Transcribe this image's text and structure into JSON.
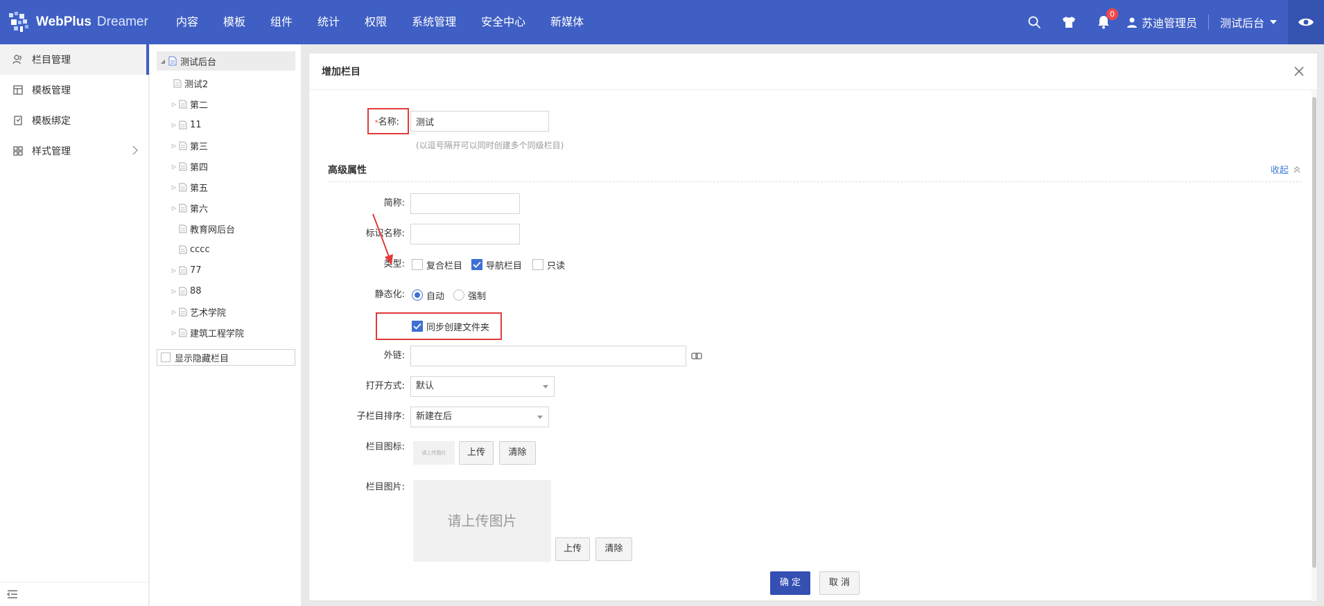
{
  "topbar": {
    "brand": "WebPlus",
    "brand_sub": "Dreamer",
    "nav": [
      "内容",
      "模板",
      "组件",
      "统计",
      "权限",
      "系统管理",
      "安全中心",
      "新媒体"
    ],
    "notification_count": "0",
    "user_name": "苏迪管理员",
    "site_name": "测试后台",
    "bg_color": "#3f5fc4"
  },
  "left_menu": {
    "items": [
      {
        "label": "栏目管理",
        "icon": "users-icon",
        "active": true
      },
      {
        "label": "模板管理",
        "icon": "layout-icon"
      },
      {
        "label": "模板绑定",
        "icon": "binding-icon"
      },
      {
        "label": "样式管理",
        "icon": "grid-icon"
      }
    ]
  },
  "tree": {
    "root": "测试后台",
    "children": [
      "测试2",
      "第二",
      "11",
      "第三",
      "第四",
      "第五",
      "第六",
      "教育网后台",
      "cccc",
      "77",
      "88",
      "艺术学院",
      "建筑工程学院"
    ],
    "show_hidden_label": "显示隐藏栏目"
  },
  "dialog": {
    "title": "增加栏目",
    "name_label": "名称:",
    "name_value": "测试",
    "name_hint": "(以逗号隔开可以同时创建多个同级栏目)",
    "advanced_title": "高级属性",
    "collapse_label": "收起",
    "short_name_label": "简称:",
    "id_name_label": "标识名称:",
    "type_label": "类型:",
    "type_options": [
      {
        "label": "复合栏目",
        "checked": false
      },
      {
        "label": "导航栏目",
        "checked": true
      },
      {
        "label": "只读",
        "checked": false
      }
    ],
    "static_label": "静态化:",
    "static_options": [
      {
        "label": "自动",
        "selected": true
      },
      {
        "label": "强制",
        "selected": false
      }
    ],
    "sync_folder_label": "同步创建文件夹",
    "sync_folder_checked": true,
    "external_link_label": "外链:",
    "open_mode_label": "打开方式:",
    "open_mode_value": "默认",
    "child_sort_label": "子栏目排序:",
    "child_sort_value": "新建在后",
    "icon_label": "栏目图标:",
    "icon_placeholder": "请上传图片",
    "image_label": "栏目图片:",
    "image_placeholder": "请上传图片",
    "upload_label": "上传",
    "clear_label": "清除",
    "confirm_label": "确 定",
    "cancel_label": "取 消"
  },
  "colors": {
    "accent": "#3e6fd3",
    "annotation_red": "#e03a3a"
  }
}
